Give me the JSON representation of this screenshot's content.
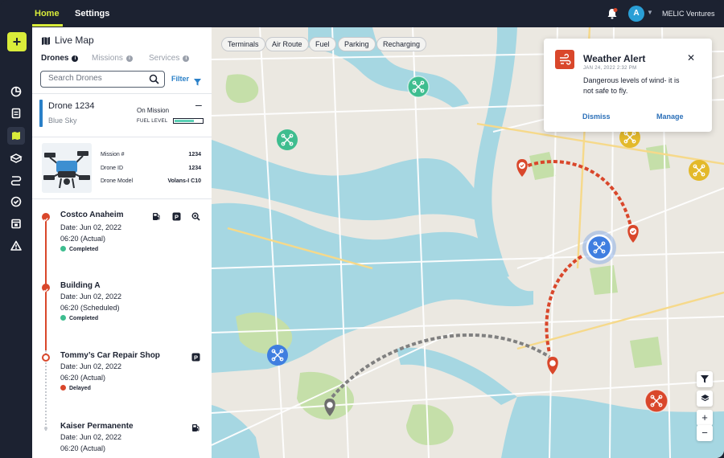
{
  "topbar": {
    "nav": {
      "home": "Home",
      "settings": "Settings"
    },
    "user": {
      "avatar_initial": "A",
      "org_name": "MELIC Ventures"
    }
  },
  "rail": {
    "items": [
      "add",
      "dashboard-icon",
      "clipboard-icon",
      "map-icon",
      "drone-icon",
      "route-icon",
      "check-circle-icon",
      "calendar-icon",
      "warning-icon"
    ],
    "active": "map-icon"
  },
  "panel": {
    "title": "Live Map",
    "tabs": [
      {
        "label": "Drones",
        "active": true
      },
      {
        "label": "Missions",
        "active": false
      },
      {
        "label": "Services",
        "active": false
      }
    ],
    "search": {
      "placeholder": "Search Drones"
    },
    "filter_label": "Filter",
    "drone": {
      "name": "Drone 1234",
      "subtitle": "Blue Sky",
      "status": "On Mission",
      "fuel_label": "FUEL LEVEL",
      "fuel_level": 0.7,
      "specs": [
        {
          "label": "Mission #",
          "value": "1234"
        },
        {
          "label": "Drone ID",
          "value": "1234"
        },
        {
          "label": "Drone Model",
          "value": "Volans-I C10"
        }
      ]
    },
    "timeline": [
      {
        "title": "Costco Anaheim",
        "date": "Date: Jun 02, 2022",
        "time": "06:20 (Actual)",
        "status": "Completed",
        "status_color": "#3ebd8f"
      },
      {
        "title": "Building A",
        "date": "Date: Jun 02, 2022",
        "time": "06:20 (Scheduled)",
        "status": "Completed",
        "status_color": "#3ebd8f"
      },
      {
        "title": "Tommy’s Car Repair Shop",
        "date": "Date: Jun 02, 2022",
        "time": "06:20 (Actual)",
        "status": "Delayed",
        "status_color": "#d9472b"
      },
      {
        "title": "Kaiser Permanente",
        "date": "Date: Jun 02, 2022",
        "time": "06:20 (Actual)"
      }
    ]
  },
  "map": {
    "chips": [
      "Terminals",
      "Air Route",
      "Fuel",
      "Parking",
      "Recharging"
    ],
    "alert": {
      "title": "Weather Alert",
      "date": "JAN 24, 2022 2:32 PM",
      "message": "Dangerous levels of wind- it is not safe to fly.",
      "dismiss": "Dismiss",
      "manage": "Manage"
    },
    "controls": {
      "zoom_in": "+",
      "zoom_out": "−"
    },
    "colors": {
      "water": "#a6d7e2",
      "land": "#ebe8e1",
      "park": "#c5dfa9",
      "route_active": "#d9472b",
      "route_pending": "#808080"
    }
  }
}
